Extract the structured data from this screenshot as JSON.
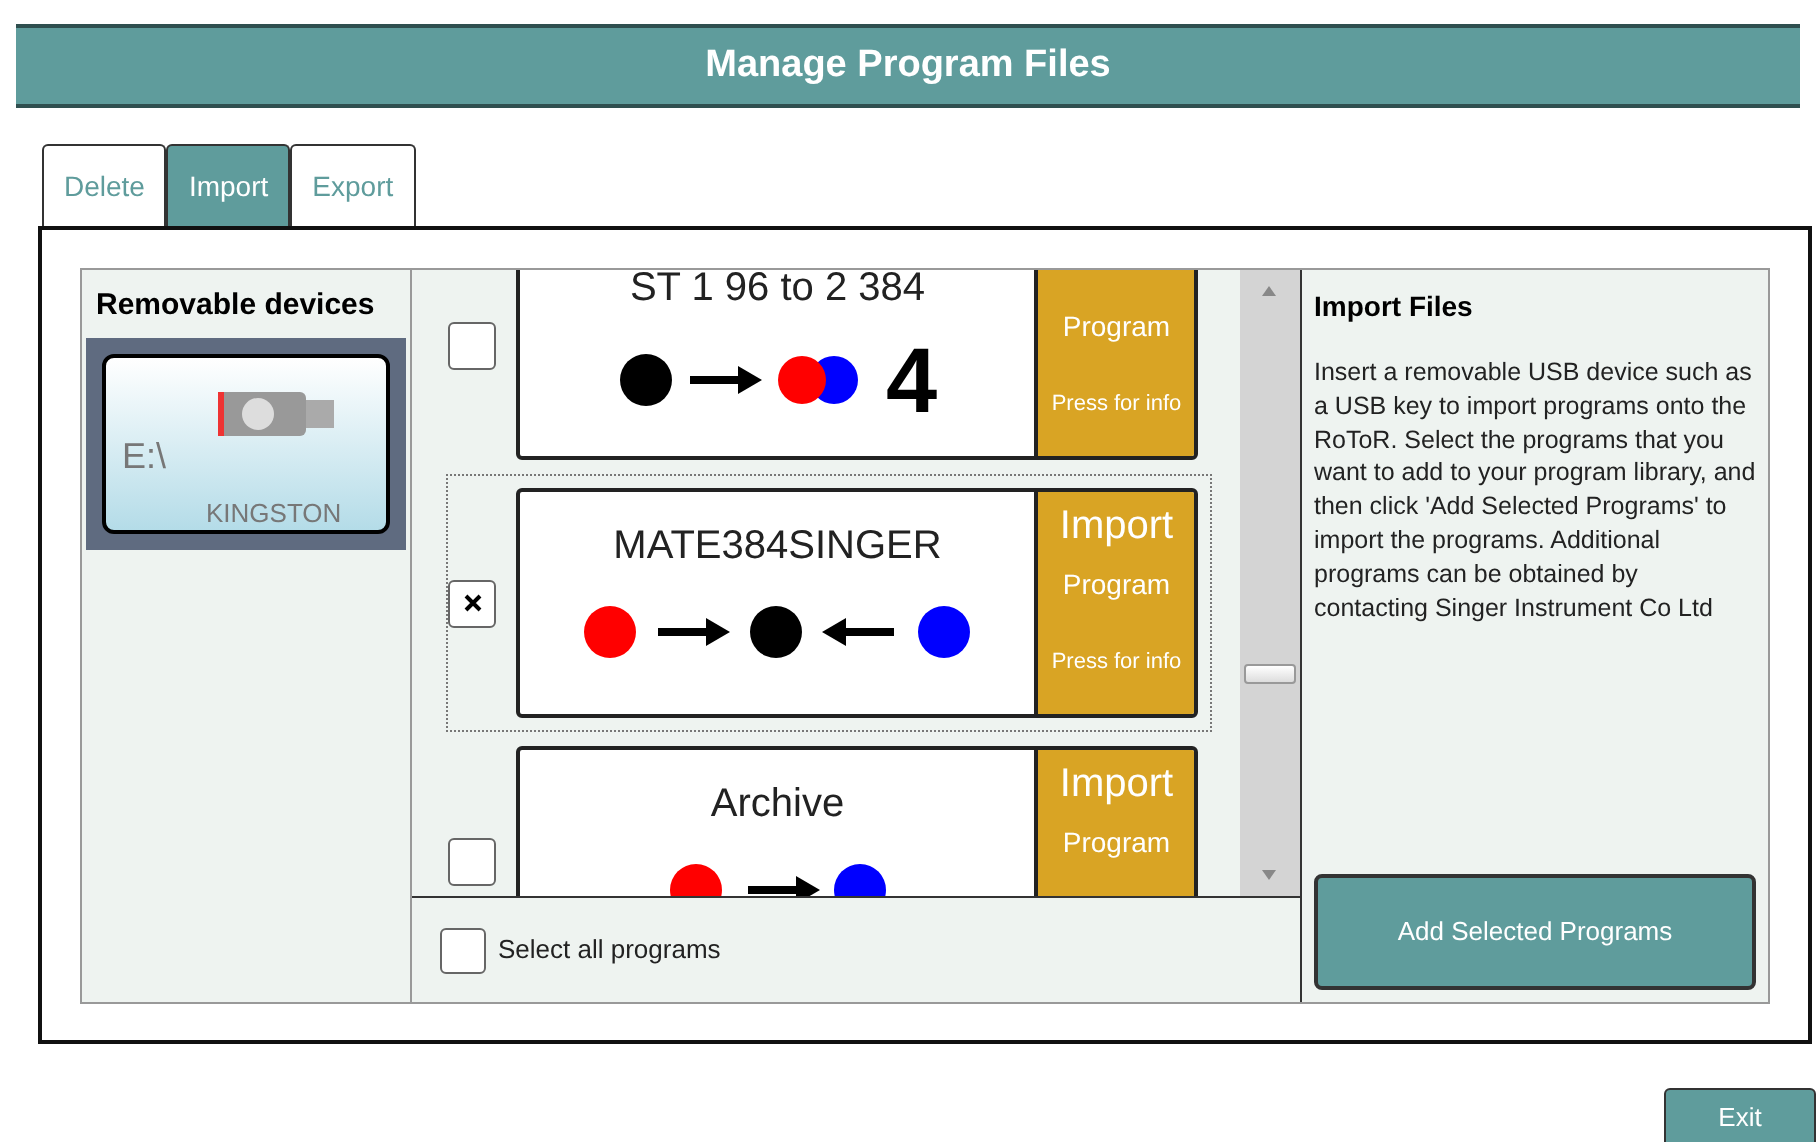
{
  "window": {
    "title": "Manage Program Files"
  },
  "tabs": [
    {
      "label": "Delete",
      "selected": false
    },
    {
      "label": "Import",
      "selected": true
    },
    {
      "label": "Export",
      "selected": false
    }
  ],
  "devices": {
    "title": "Removable devices",
    "items": [
      {
        "drive": "E:\\",
        "name": "KINGSTON",
        "selected": true
      }
    ]
  },
  "programs": [
    {
      "title": "ST 1 96 to 2 384",
      "action_sub": "Program",
      "info": "Press for info",
      "checked": false,
      "selected": false,
      "kind": "split",
      "badge": "4"
    },
    {
      "title": "MATE384SINGER",
      "action": "Import",
      "action_sub": "Program",
      "info": "Press for info",
      "checked": true,
      "selected": true,
      "kind": "merge"
    },
    {
      "title": "Archive",
      "action": "Import",
      "action_sub": "Program",
      "checked": false,
      "selected": false,
      "kind": "transfer"
    }
  ],
  "select_all": {
    "label": "Select all programs",
    "checked": false
  },
  "info_panel": {
    "title": "Import Files",
    "text": "Insert a removable USB device such as a USB key to import programs onto the RoToR. Select the programs that you want to add to your program library, and then click 'Add Selected Programs' to import the programs. Additional programs can be obtained by contacting Singer Instrument Co Ltd"
  },
  "add_button": "Add Selected Programs",
  "exit_button": "Exit"
}
